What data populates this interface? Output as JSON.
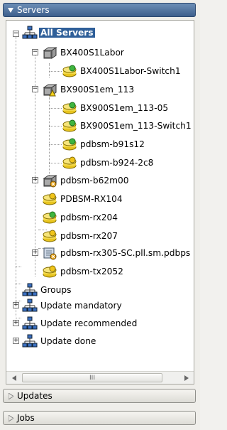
{
  "panels": {
    "servers_label": "Servers",
    "updates_label": "Updates",
    "jobs_label": "Jobs"
  },
  "tree": {
    "all_servers": "All Servers",
    "bx400": "BX400S1Labor",
    "bx400_switch": "BX400S1Labor-Switch1",
    "bx900": "BX900S1em_113",
    "bx900_05": "BX900S1em_113-05",
    "bx900_switch": "BX900S1em_113-Switch1",
    "pdbsm_b91s12": "pdbsm-b91s12",
    "pdbsm_b924": "pdbsm-b924-2c8",
    "pdbsm_b62m00": "pdbsm-b62m00",
    "pdbsm_rx104": "PDBSM-RX104",
    "pdbsm_rx204": "pdbsm-rx204",
    "pdbsm_rx207": "pdbsm-rx207",
    "pdbsm_rx305": "pdbsm-rx305-SC.pll.sm.pdbps",
    "pdbsm_tx2052": "pdbsm-tx2052",
    "groups": "Groups",
    "update_mandatory": "Update mandatory",
    "update_recommended": "Update recommended",
    "update_done": "Update done"
  },
  "scrollbar": {
    "thumb_grip": "III"
  },
  "colors": {
    "selection": "#2f5f99",
    "active_header": "#3d5f8c",
    "server_ok": "#3fb53f",
    "server_warn": "#e6c419"
  }
}
